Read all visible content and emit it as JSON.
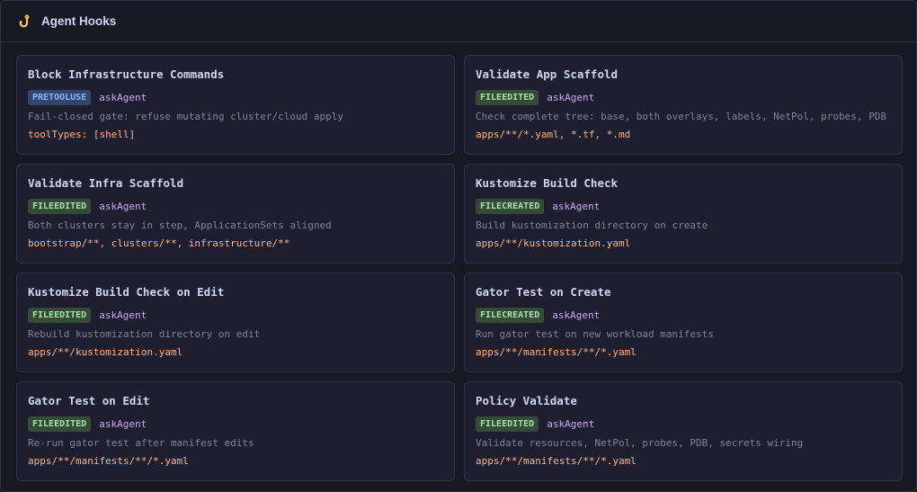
{
  "header": {
    "title": "Agent Hooks",
    "icon": "hook-icon",
    "icon_color": "#f9c74f"
  },
  "colors": {
    "background": "#181825",
    "card": "#1e1e2e",
    "border": "#313244",
    "badge_pretooluse": "#89b4fa",
    "badge_file": "#a6e3a1",
    "agent": "#cba6f7",
    "pattern": "#fab387"
  },
  "hooks": [
    {
      "title": "Block Infrastructure Commands",
      "event": "PRETOOLUSE",
      "action": "askAgent",
      "description": "Fail-closed gate: refuse mutating cluster/cloud apply",
      "pattern": "toolTypes: [shell]"
    },
    {
      "title": "Validate App Scaffold",
      "event": "FILEEDITED",
      "action": "askAgent",
      "description": "Check complete tree: base, both overlays, labels, NetPol, probes, PDB",
      "pattern": "apps/**/*.yaml, *.tf, *.md"
    },
    {
      "title": "Validate Infra Scaffold",
      "event": "FILEEDITED",
      "action": "askAgent",
      "description": "Both clusters stay in step, ApplicationSets aligned",
      "pattern": "bootstrap/**, clusters/**, infrastructure/**"
    },
    {
      "title": "Kustomize Build Check",
      "event": "FILECREATED",
      "action": "askAgent",
      "description": "Build kustomization directory on create",
      "pattern": "apps/**/kustomization.yaml"
    },
    {
      "title": "Kustomize Build Check on Edit",
      "event": "FILEEDITED",
      "action": "askAgent",
      "description": "Rebuild kustomization directory on edit",
      "pattern": "apps/**/kustomization.yaml"
    },
    {
      "title": "Gator Test on Create",
      "event": "FILECREATED",
      "action": "askAgent",
      "description": "Run gator test on new workload manifests",
      "pattern": "apps/**/manifests/**/*.yaml"
    },
    {
      "title": "Gator Test on Edit",
      "event": "FILEEDITED",
      "action": "askAgent",
      "description": "Re-run gator test after manifest edits",
      "pattern": "apps/**/manifests/**/*.yaml"
    },
    {
      "title": "Policy Validate",
      "event": "FILEEDITED",
      "action": "askAgent",
      "description": "Validate resources, NetPol, probes, PDB, secrets wiring",
      "pattern": "apps/**/manifests/**/*.yaml"
    }
  ]
}
